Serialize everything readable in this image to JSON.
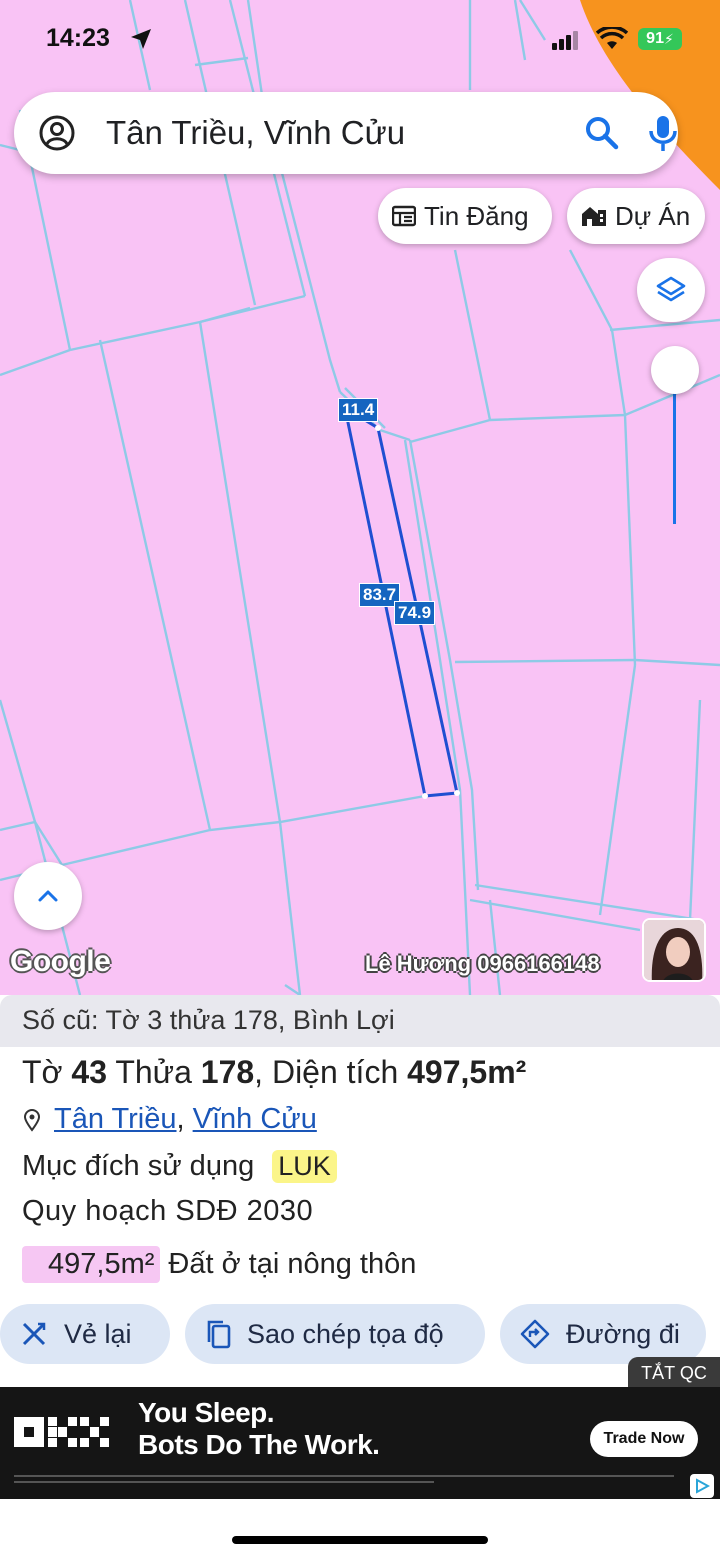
{
  "status_bar": {
    "time": "14:23",
    "battery": "91"
  },
  "search": {
    "query": "Tân Triều, Vĩnh Cửu"
  },
  "chips": {
    "tin_dang": "Tin Đăng",
    "du_an": "Dự Án"
  },
  "map": {
    "dimensions": {
      "top": "11.4",
      "left": "83.7",
      "right": "74.9"
    },
    "attribution": "Google",
    "watermark": "Lê Hương 0966166148"
  },
  "parcel": {
    "old_number": "Số cũ: Tờ 3 thửa 178, Bình Lợi",
    "title_prefix": "Tờ",
    "sheet": "43",
    "plot_label": "Thửa",
    "plot": "178",
    "area_label": ", Diện tích",
    "area": "497,5m²",
    "ward": "Tân Triều",
    "district": "Vĩnh Cửu",
    "purpose_label": "Mục đích sử dụng",
    "purpose_code": "LUK",
    "plan_label": "Quy hoạch SDĐ 2030",
    "plan_area": "497,5m²",
    "plan_type": "Đất ở tại nông thôn"
  },
  "actions": {
    "redraw": "Vẻ lại",
    "copy_coords": "Sao chép tọa độ",
    "directions": "Đường đi"
  },
  "ad": {
    "hide_label": "TẮT QC",
    "headline_1": "You Sleep.",
    "headline_2": "Bots Do The Work.",
    "cta": "Trade Now"
  },
  "colors": {
    "map_bg": "#f9c3f5",
    "parcel_line": "#8ecae6",
    "highlight": "#1f4fd1",
    "accent": "#1a73e8"
  }
}
